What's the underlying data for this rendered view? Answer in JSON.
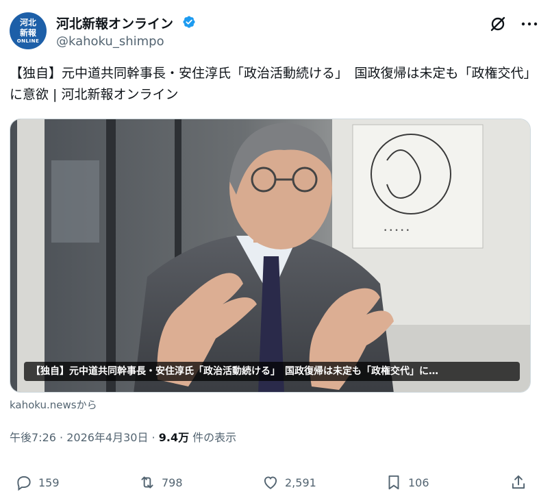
{
  "account": {
    "display_name": "河北新報オンライン",
    "handle": "@kahoku_shimpo",
    "avatar": {
      "line1": "河北",
      "line2": "新報",
      "line3": "ONLINE",
      "color": "#1d5fa8"
    },
    "verified_color": "#1d9bf0"
  },
  "icons": {
    "verified": "verified-badge-icon",
    "grok": "grok-icon",
    "more": "more-icon"
  },
  "post": {
    "text": "【独自】元中道共同幹事長・安住淳氏「政治活動続ける」　国政復帰は未定も「政権交代」に意欲 | 河北新報オンライン"
  },
  "media": {
    "caption": "【独自】元中道共同幹事長・安住淳氏「政治活動続ける」　国政復帰は未定も「政権交代」に…"
  },
  "source": "kahoku.newsから",
  "meta": {
    "time": "午後7:26",
    "sep1": " · ",
    "date": "2026年4月30日",
    "sep2": " · ",
    "views": "9.4万",
    "views_label": " 件の表示"
  },
  "actions": {
    "replies": "159",
    "reposts": "798",
    "likes": "2,591",
    "bookmarks": "106"
  }
}
